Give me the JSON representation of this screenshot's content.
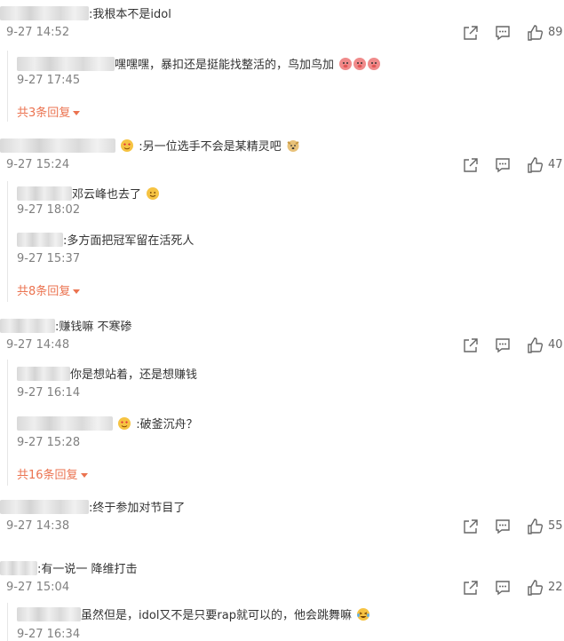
{
  "comments": [
    {
      "text": ":我根本不是idol",
      "time": "9-27 14:52",
      "likes": "89",
      "replies": [
        {
          "text": "嘿嘿嘿，暴扣还是挺能找整活的，鸟加鸟加",
          "time": "9-27 17:45"
        }
      ],
      "more": "共3条回复"
    },
    {
      "text": ":另一位选手不会是某精灵吧",
      "time": "9-27 15:24",
      "likes": "47",
      "replies": [
        {
          "text": "邓云峰也去了",
          "time": "9-27 18:02"
        },
        {
          "text": ":多方面把冠军留在活死人",
          "time": "9-27 15:37"
        }
      ],
      "more": "共8条回复"
    },
    {
      "text": ":赚钱嘛 不寒碜",
      "time": "9-27 14:48",
      "likes": "40",
      "replies": [
        {
          "text": "你是想站着，还是想赚钱",
          "time": "9-27 16:14"
        },
        {
          "text": ":破釜沉舟？",
          "time": "9-27 15:28"
        }
      ],
      "more": "共16条回复"
    },
    {
      "text": ":终于参加对节目了",
      "time": "9-27 14:38",
      "likes": "55"
    },
    {
      "text": ":有一说一 降维打击",
      "time": "9-27 15:04",
      "likes": "22",
      "replies": [
        {
          "text": "虽然但是，idol又不是只要rap就可以的，他会跳舞嘛",
          "time": "9-27 16:34"
        }
      ]
    }
  ],
  "icons": {
    "share": "share-icon",
    "comment": "comment-icon",
    "like": "thumbs-up-icon"
  },
  "colors": {
    "link": "#eb7350",
    "time": "#808080",
    "text": "#333333"
  }
}
